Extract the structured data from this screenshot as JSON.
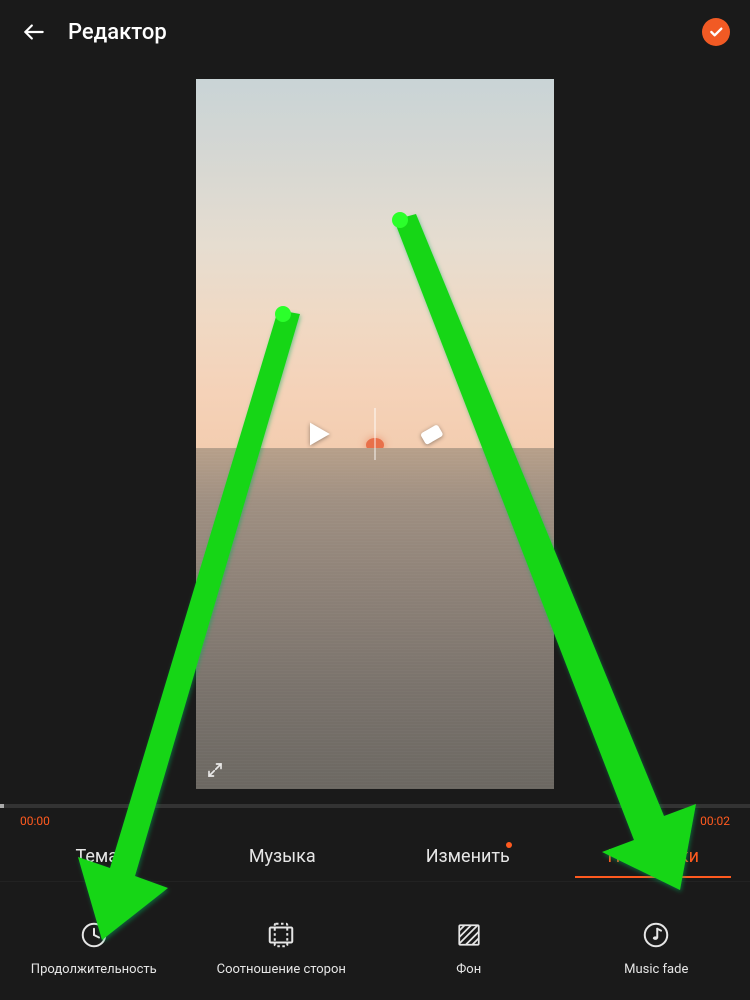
{
  "colors": {
    "accent": "#ff5a1f",
    "bg": "#1a1a1a"
  },
  "header": {
    "title": "Редактор"
  },
  "timeline": {
    "start": "00:00",
    "end": "00:02"
  },
  "tabs": [
    {
      "id": "theme",
      "label": "Тема",
      "active": false,
      "dot": false
    },
    {
      "id": "music",
      "label": "Музыка",
      "active": false,
      "dot": false
    },
    {
      "id": "edit",
      "label": "Изменить",
      "active": false,
      "dot": true
    },
    {
      "id": "settings",
      "label": "Настройки",
      "active": true,
      "dot": false
    }
  ],
  "tools": [
    {
      "id": "duration",
      "label": "Продолжительность",
      "icon": "clock-icon"
    },
    {
      "id": "aspect",
      "label": "Соотношение сторон",
      "icon": "aspect-icon"
    },
    {
      "id": "background",
      "label": "Фон",
      "icon": "pattern-icon"
    },
    {
      "id": "musicfade",
      "label": "Music fade",
      "icon": "music-fade-icon"
    }
  ],
  "icons": {
    "back": "back-arrow-icon",
    "done": "checkmark-circle-icon",
    "play": "play-icon",
    "erase": "eraser-icon",
    "expand": "expand-icon"
  }
}
